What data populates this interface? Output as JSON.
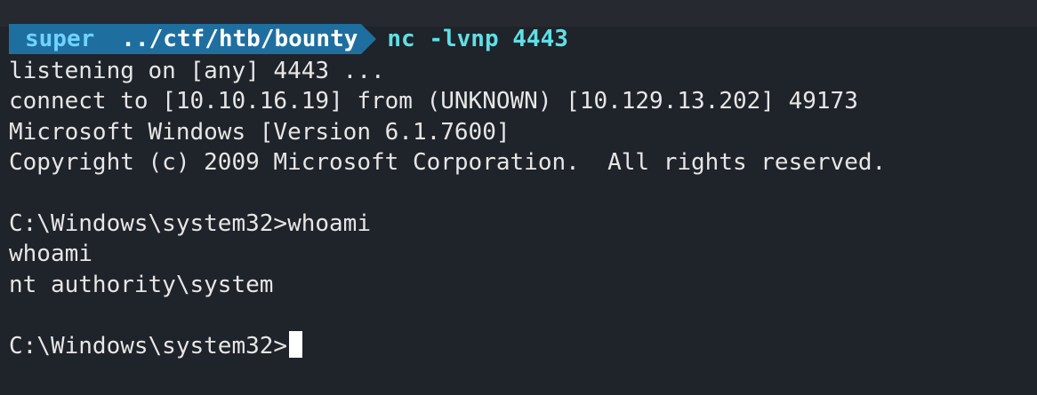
{
  "prompt": {
    "user": "super",
    "path": "../ctf/htb/bounty",
    "command": "nc -lvnp 4443"
  },
  "output": {
    "listening": "listening on [any] 4443 ...",
    "connect": "connect to [10.10.16.19] from (UNKNOWN) [10.129.13.202] 49173",
    "windows_version": "Microsoft Windows [Version 6.1.7600]",
    "copyright": "Copyright (c) 2009 Microsoft Corporation.  All rights reserved.",
    "cmd1": "C:\\Windows\\system32>whoami",
    "echo": "whoami",
    "result": "nt authority\\system",
    "cmd2": "C:\\Windows\\system32>"
  },
  "colors": {
    "background": "#1f232a",
    "prompt_segment": "#1e6fa0",
    "user_text": "#6fd3ff",
    "command_text": "#5ee0e6",
    "output_text": "#e6e6e6"
  }
}
